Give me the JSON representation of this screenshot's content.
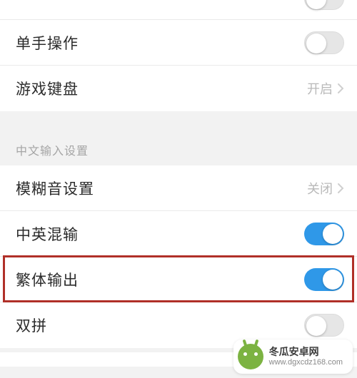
{
  "rows": [
    {
      "key": "partial_top",
      "label": "",
      "type": "switch",
      "state": "off"
    },
    {
      "key": "one_hand",
      "label": "单手操作",
      "type": "switch",
      "state": "off"
    },
    {
      "key": "game_kb",
      "label": "游戏键盘",
      "type": "value_nav",
      "value": "开启"
    }
  ],
  "section": {
    "title": "中文输入设置",
    "rows": [
      {
        "key": "fuzzy",
        "label": "模糊音设置",
        "type": "value_nav",
        "value": "关闭"
      },
      {
        "key": "mix",
        "label": "中英混输",
        "type": "switch",
        "state": "on"
      },
      {
        "key": "trad",
        "label": "繁体输出",
        "type": "switch",
        "state": "on",
        "highlighted": true
      },
      {
        "key": "shuang",
        "label": "双拼",
        "type": "switch",
        "state": "off"
      }
    ]
  },
  "watermark": {
    "name": "冬瓜安卓网",
    "url": "www.dgxcdz168.com"
  }
}
